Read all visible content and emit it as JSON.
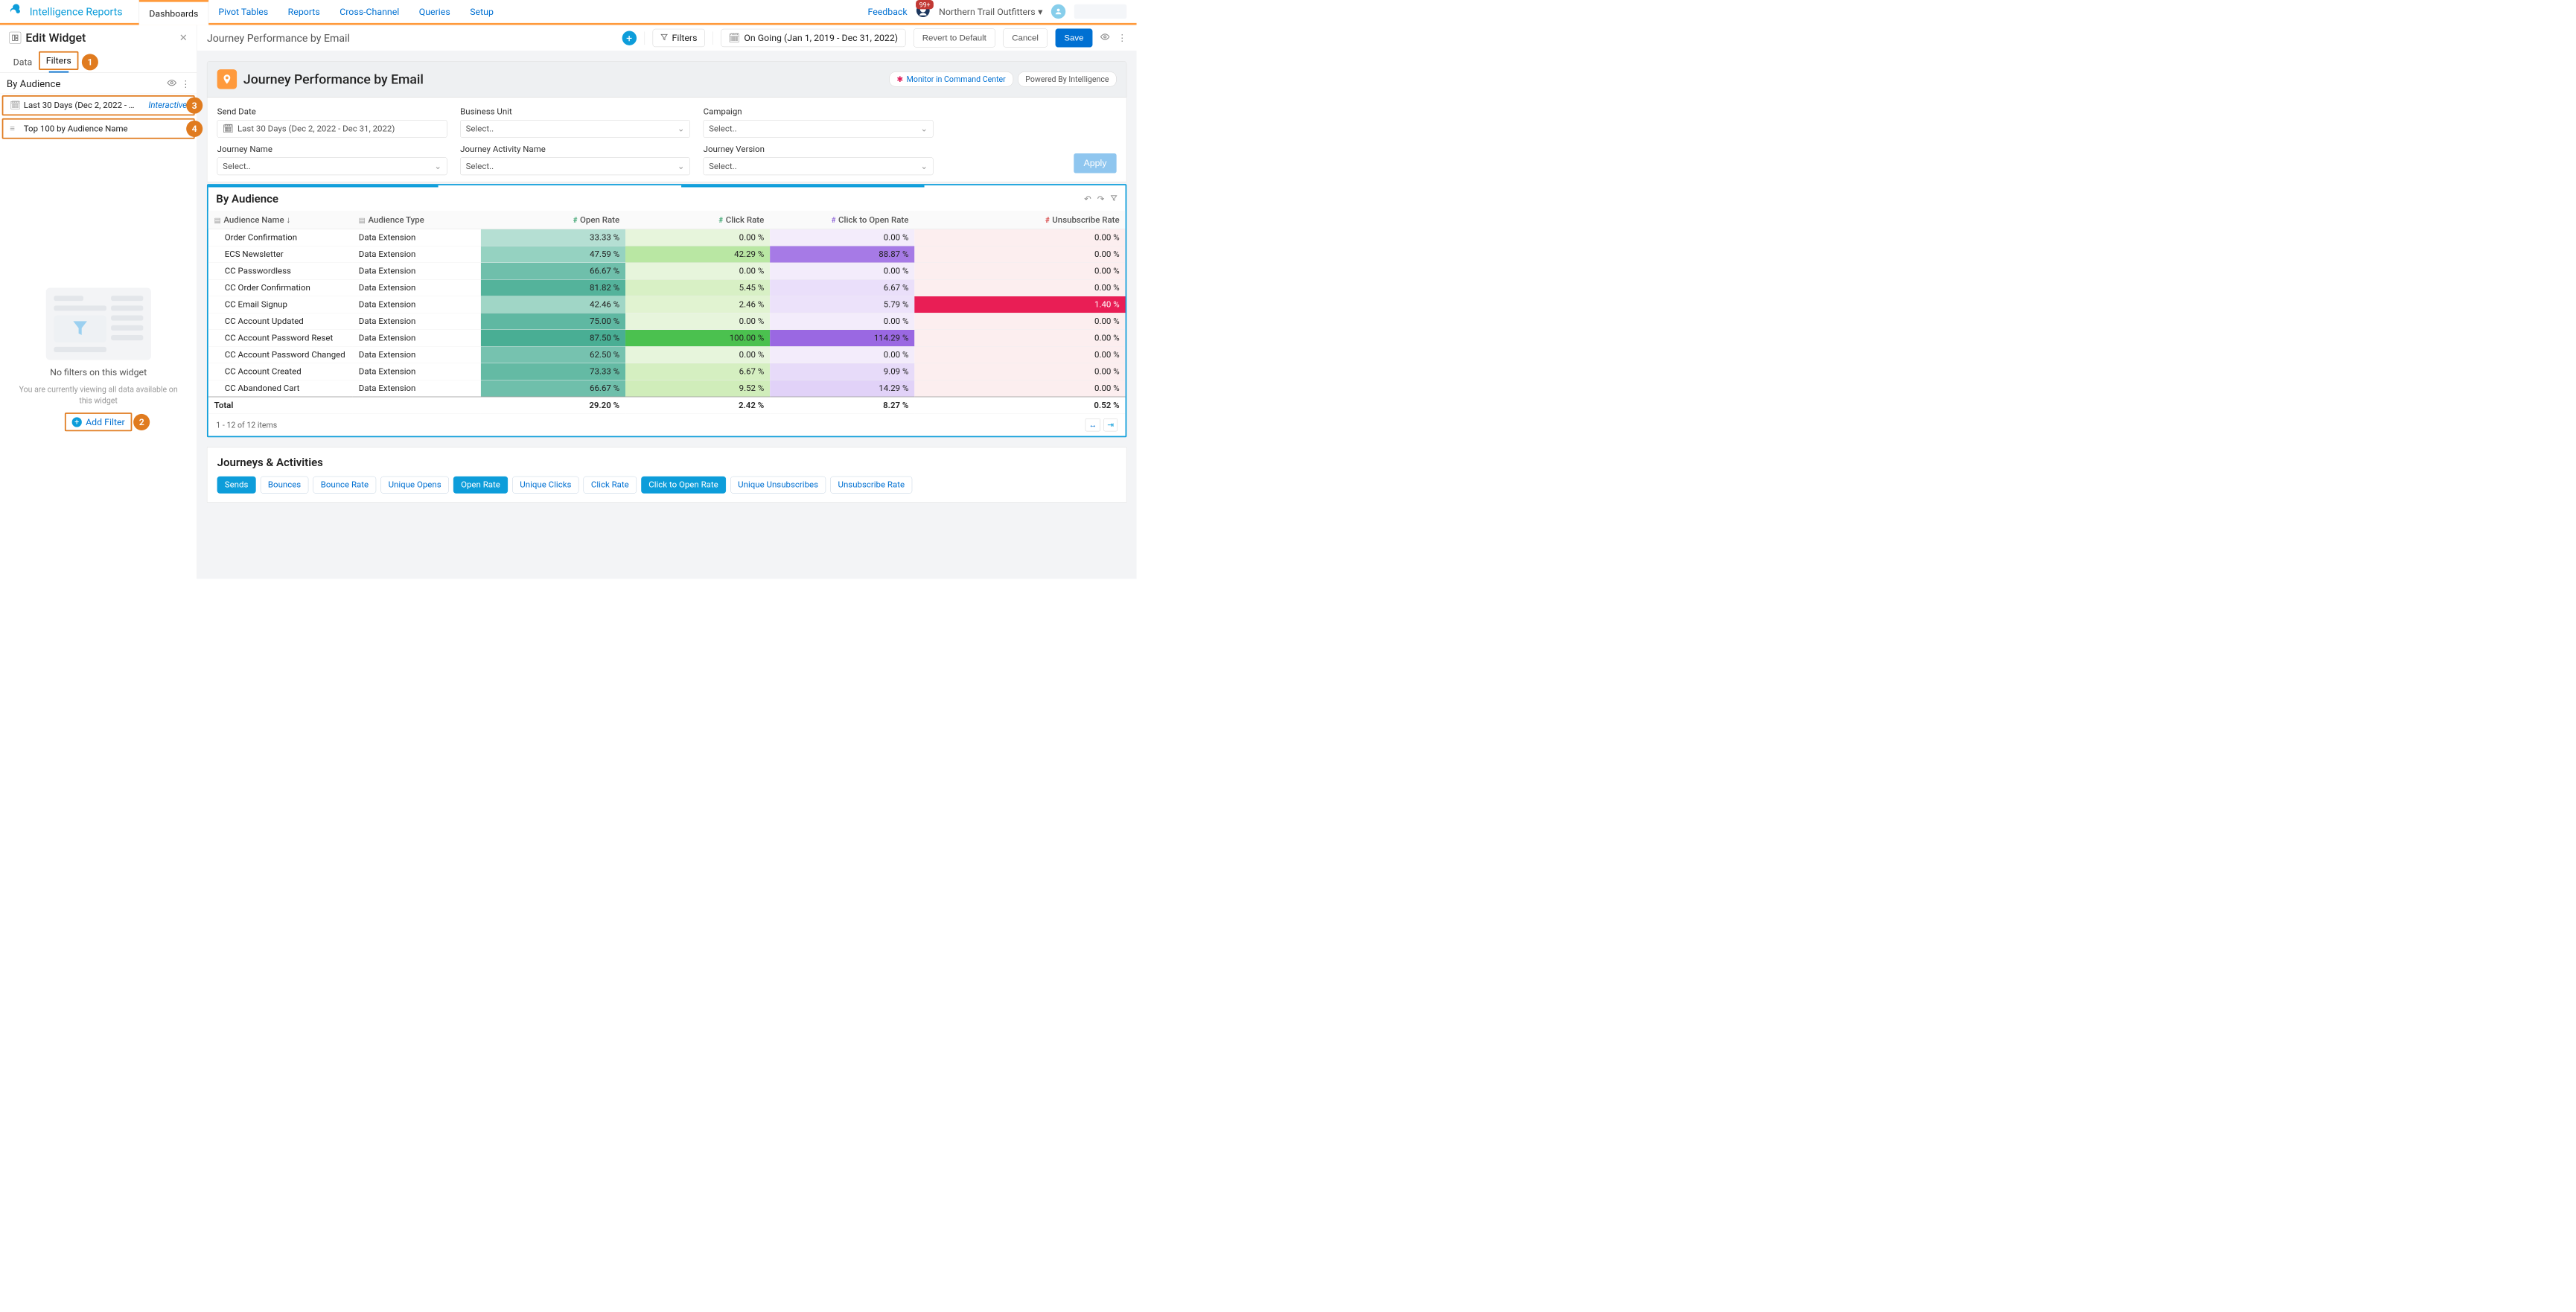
{
  "brand": "Intelligence Reports",
  "nav": {
    "tabs": [
      "Dashboards",
      "Pivot Tables",
      "Reports",
      "Cross-Channel",
      "Queries",
      "Setup"
    ],
    "active": 0,
    "feedback": "Feedback",
    "notif_count": "99+",
    "org": "Northern Trail Outfitters"
  },
  "side": {
    "title": "Edit Widget",
    "tabs": {
      "data": "Data",
      "filters": "Filters"
    },
    "by_audience": "By Audience",
    "filter1": {
      "text": "Last 30 Days (Dec 2, 2022 - …",
      "badge": "Interactive"
    },
    "filter2": {
      "text": "Top 100 by Audience Name"
    },
    "nf_title": "No filters on this widget",
    "nf_sub": "You are currently viewing all data available on this widget",
    "add_filter": "Add Filter"
  },
  "callouts": {
    "c1": "1",
    "c2": "2",
    "c3": "3",
    "c4": "4"
  },
  "toolbar": {
    "crumb": "Journey Performance by Email",
    "filters": "Filters",
    "date": "On Going (Jan 1, 2019 - Dec 31, 2022)",
    "revert": "Revert to Default",
    "cancel": "Cancel",
    "save": "Save"
  },
  "dash": {
    "title": "Journey Performance by Email",
    "chip1": "Monitor in Command Center",
    "chip2": "Powered By Intelligence"
  },
  "fgrid": {
    "send_date": {
      "label": "Send Date",
      "value": "Last 30 Days (Dec 2, 2022 - Dec 31, 2022)"
    },
    "bu": {
      "label": "Business Unit",
      "value": "Select.."
    },
    "campaign": {
      "label": "Campaign",
      "value": "Select.."
    },
    "jname": {
      "label": "Journey Name",
      "value": "Select.."
    },
    "janame": {
      "label": "Journey Activity Name",
      "value": "Select.."
    },
    "jver": {
      "label": "Journey Version",
      "value": "Select.."
    },
    "apply": "Apply"
  },
  "widget": {
    "title": "By Audience",
    "cols": {
      "name": "Audience Name",
      "type": "Audience Type",
      "open": "Open Rate",
      "click": "Click Rate",
      "cto": "Click to Open Rate",
      "unsub": "Unsubscribe Rate"
    },
    "rows": [
      {
        "n": "Order Confirmation",
        "t": "Data Extension",
        "o": "33.33 %",
        "oc": "#b5dfd3",
        "c": "0.00 %",
        "cc": "#e7f5dc",
        "cto": "0.00 %",
        "ctc": "#f3ecfb",
        "u": "0.00 %",
        "uc": "#fceeef"
      },
      {
        "n": "ECS Newsletter",
        "t": "Data Extension",
        "o": "47.59 %",
        "oc": "#95d2c1",
        "c": "42.29 %",
        "cc": "#b9e7a3",
        "cto": "88.87 %",
        "ctc": "#a67ae6",
        "u": "0.00 %",
        "uc": "#fceeef"
      },
      {
        "n": "CC Passwordless",
        "t": "Data Extension",
        "o": "66.67 %",
        "oc": "#6fbfab",
        "c": "0.00 %",
        "cc": "#e7f5dc",
        "cto": "0.00 %",
        "ctc": "#f3ecfb",
        "u": "0.00 %",
        "uc": "#fceeef"
      },
      {
        "n": "CC Order Confirmation",
        "t": "Data Extension",
        "o": "81.82 %",
        "oc": "#54b39b",
        "c": "5.45 %",
        "cc": "#d8f0c5",
        "cto": "6.67 %",
        "ctc": "#eadffa",
        "u": "0.00 %",
        "uc": "#fceeef"
      },
      {
        "n": "CC Email Signup",
        "t": "Data Extension",
        "o": "42.46 %",
        "oc": "#a0d6c6",
        "c": "2.46 %",
        "cc": "#e1f3d1",
        "cto": "5.79 %",
        "ctc": "#ece2fa",
        "u": "1.40 %",
        "uc": "#e91e55"
      },
      {
        "n": "CC Account Updated",
        "t": "Data Extension",
        "o": "75.00 %",
        "oc": "#5fb8a2",
        "c": "0.00 %",
        "cc": "#e7f5dc",
        "cto": "0.00 %",
        "ctc": "#f3ecfb",
        "u": "0.00 %",
        "uc": "#fceeef"
      },
      {
        "n": "CC Account Password Reset",
        "t": "Data Extension",
        "o": "87.50 %",
        "oc": "#49ae94",
        "c": "100.00 %",
        "cc": "#4bc14f",
        "cto": "114.29 %",
        "ctc": "#9a68e2",
        "u": "0.00 %",
        "uc": "#fceeef"
      },
      {
        "n": "CC Account Password Changed",
        "t": "Data Extension",
        "o": "62.50 %",
        "oc": "#76c2af",
        "c": "0.00 %",
        "cc": "#e7f5dc",
        "cto": "0.00 %",
        "ctc": "#f3ecfb",
        "u": "0.00 %",
        "uc": "#fceeef"
      },
      {
        "n": "CC Account Created",
        "t": "Data Extension",
        "o": "73.33 %",
        "oc": "#64baa4",
        "c": "6.67 %",
        "cc": "#d5efc1",
        "cto": "9.09 %",
        "ctc": "#e7dbf9",
        "u": "0.00 %",
        "uc": "#fceeef"
      },
      {
        "n": "CC Abandoned Cart",
        "t": "Data Extension",
        "o": "66.67 %",
        "oc": "#6fbfab",
        "c": "9.52 %",
        "cc": "#d0edba",
        "cto": "14.29 %",
        "ctc": "#e1d2f8",
        "u": "0.00 %",
        "uc": "#fceeef"
      }
    ],
    "total": {
      "label": "Total",
      "o": "29.20 %",
      "c": "2.42 %",
      "cto": "8.27 %",
      "u": "0.52 %"
    },
    "pager": "1 - 12 of 12 items"
  },
  "section2": {
    "title": "Journeys & Activities",
    "pills": [
      {
        "t": "Sends",
        "on": true
      },
      {
        "t": "Bounces",
        "on": false
      },
      {
        "t": "Bounce Rate",
        "on": false
      },
      {
        "t": "Unique Opens",
        "on": false
      },
      {
        "t": "Open Rate",
        "on": true
      },
      {
        "t": "Unique Clicks",
        "on": false
      },
      {
        "t": "Click Rate",
        "on": false
      },
      {
        "t": "Click to Open Rate",
        "on": true
      },
      {
        "t": "Unique Unsubscribes",
        "on": false
      },
      {
        "t": "Unsubscribe Rate",
        "on": false
      }
    ]
  }
}
